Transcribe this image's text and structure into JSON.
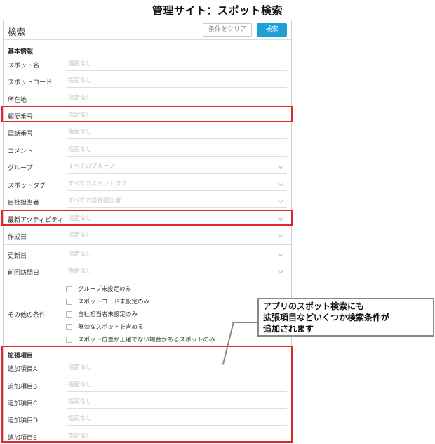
{
  "page_heading": "管理サイト：スポット検索",
  "header": {
    "title": "検索",
    "clear_label": "条件をクリア",
    "search_label": "検索"
  },
  "basic_section_title": "基本情報",
  "fields": {
    "spot_name": {
      "label": "スポット名",
      "placeholder": "指定なし"
    },
    "spot_code": {
      "label": "スポットコード",
      "placeholder": "指定なし"
    },
    "address": {
      "label": "所在地",
      "placeholder": "指定なし"
    },
    "postal": {
      "label": "郵便番号",
      "placeholder": "指定なし"
    },
    "phone": {
      "label": "電話番号",
      "placeholder": "指定なし"
    },
    "comment": {
      "label": "コメント",
      "placeholder": "指定なし"
    },
    "group": {
      "label": "グループ",
      "placeholder": "すべてのグループ"
    },
    "spot_tag": {
      "label": "スポットタグ",
      "placeholder": "すべてのスポットタグ"
    },
    "staff": {
      "label": "自社担当者",
      "placeholder": "すべての自社担当者"
    },
    "latest_activity": {
      "label": "最新アクティビティ",
      "placeholder": "指定なし"
    },
    "created": {
      "label": "作成日",
      "placeholder": "指定なし"
    },
    "updated": {
      "label": "更新日",
      "placeholder": "指定なし"
    },
    "last_visit": {
      "label": "前回訪問日",
      "placeholder": "指定なし"
    }
  },
  "other_conditions": {
    "label": "その他の条件",
    "options": [
      "グループ未設定のみ",
      "スポットコード未設定のみ",
      "自社担当者未設定のみ",
      "無効なスポットを含める",
      "スポット位置が正確でない場合があるスポットのみ"
    ]
  },
  "extended_section_title": "拡張項目",
  "extended_fields": [
    {
      "label": "追加項目A",
      "placeholder": "指定なし"
    },
    {
      "label": "追加項目B",
      "placeholder": "指定なし"
    },
    {
      "label": "追加項目C",
      "placeholder": "指定なし"
    },
    {
      "label": "追加項目D",
      "placeholder": "指定なし"
    },
    {
      "label": "追加項目E",
      "placeholder": "指定なし"
    }
  ],
  "callout": {
    "line1": "アプリのスポット検索にも",
    "line2": "拡張項目などいくつか検索条件が",
    "line3": "追加されます"
  },
  "colors": {
    "accent": "#1e9fd6",
    "highlight": "#e3262e"
  },
  "icons": [
    "chevron-down-icon",
    "checkbox-icon"
  ]
}
